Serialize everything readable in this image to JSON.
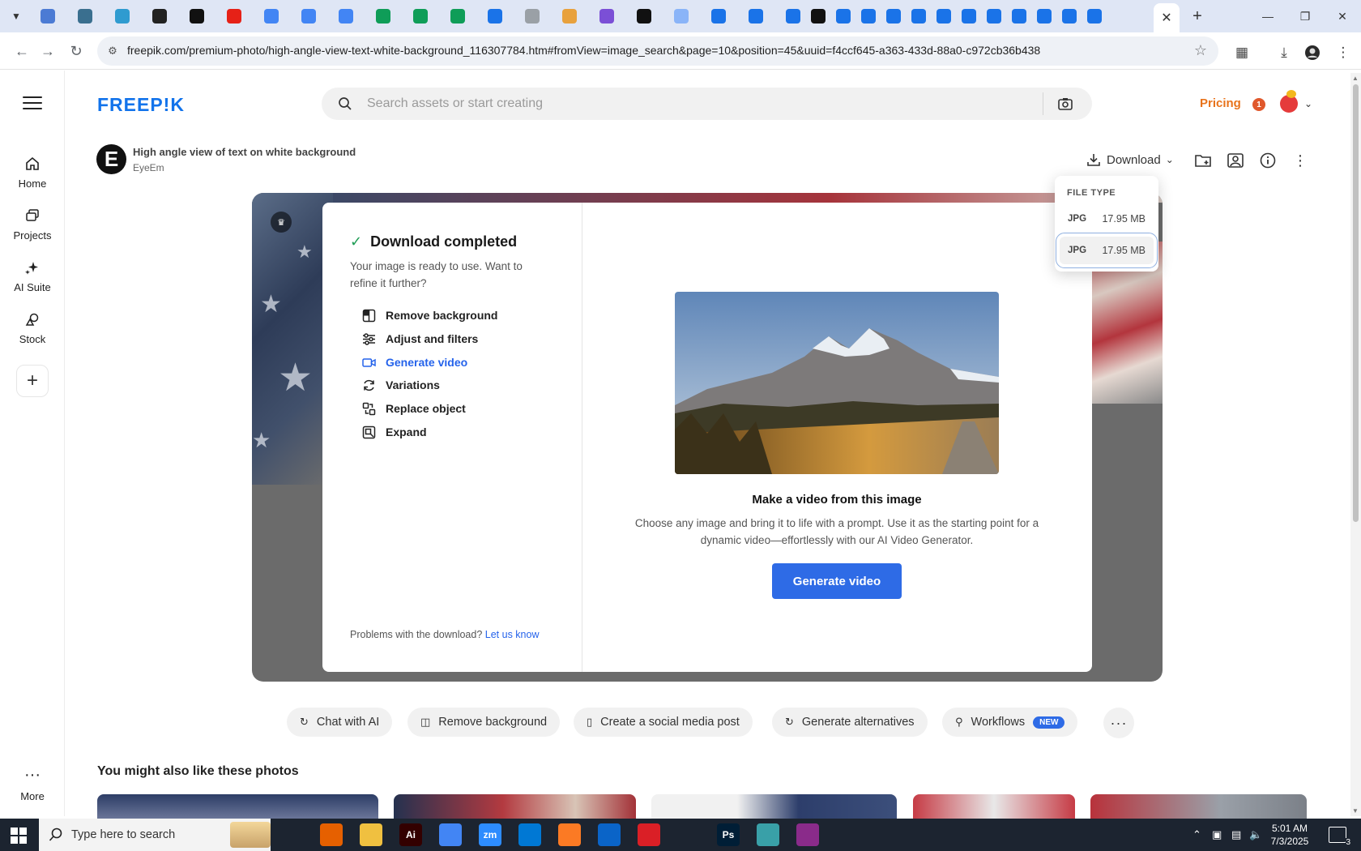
{
  "browser": {
    "url": "freepik.com/premium-photo/high-angle-view-text-white-background_116307784.htm#fromView=image_search&page=10&position=45&uuid=f4ccf645-a363-433d-88a0-c972cb36b438",
    "favicon_colors": [
      "#4c7bd4",
      "#3a6f8f",
      "#2f9bd0",
      "#222222",
      "#111111",
      "#e62117",
      "#4285f4",
      "#4285f4",
      "#4285f4",
      "#0f9d58",
      "#0f9d58",
      "#0f9d58",
      "#1a73e8",
      "#9aa0a6",
      "#e8a13d",
      "#7b4fd6",
      "#111111",
      "#8ab4f8",
      "#1a73e8",
      "#1a73e8",
      "#1a73e8",
      "#111111",
      "#1a73e8",
      "#1a73e8",
      "#1a73e8",
      "#1a73e8",
      "#1a73e8",
      "#1a73e8",
      "#1a73e8",
      "#1a73e8",
      "#1a73e8",
      "#1a73e8",
      "#1a73e8"
    ]
  },
  "header": {
    "logo": "FREEP!K",
    "search_placeholder": "Search assets or start creating",
    "pricing_label": "Pricing",
    "notification_count": "1"
  },
  "sidebar": {
    "items": [
      {
        "label": "Home",
        "icon": "home-icon"
      },
      {
        "label": "Projects",
        "icon": "projects-icon"
      },
      {
        "label": "AI Suite",
        "icon": "sparkle-icon"
      },
      {
        "label": "Stock",
        "icon": "stock-icon"
      }
    ],
    "more_label": "More"
  },
  "asset": {
    "author_initial": "E",
    "title": "High angle view of text on white background",
    "author": "EyeEm",
    "download_label": "Download"
  },
  "file_type": {
    "heading": "FILE TYPE",
    "options": [
      {
        "type": "JPG",
        "size": "17.95 MB"
      },
      {
        "type": "JPG",
        "size": "17.95 MB"
      }
    ]
  },
  "modal": {
    "title": "Download completed",
    "subtitle": "Your image is ready to use. Want to refine it further?",
    "actions": [
      {
        "label": "Remove background",
        "icon": "remove-background-icon"
      },
      {
        "label": "Adjust and filters",
        "icon": "sliders-icon"
      },
      {
        "label": "Generate video",
        "icon": "video-icon"
      },
      {
        "label": "Variations",
        "icon": "refresh-icon"
      },
      {
        "label": "Replace object",
        "icon": "replace-object-icon"
      },
      {
        "label": "Expand",
        "icon": "expand-icon"
      }
    ],
    "problem_text": "Problems with the download?",
    "problem_link": "Let us know",
    "video_title": "Make a video from this image",
    "video_desc": "Choose any image and bring it to life with a prompt. Use it as the starting point for a dynamic video—effortlessly with our AI Video Generator.",
    "video_button": "Generate video"
  },
  "chips": [
    {
      "label": "Chat with AI",
      "icon": "chat-icon"
    },
    {
      "label": "Remove background",
      "icon": "remove-background-icon"
    },
    {
      "label": "Create a social media post",
      "icon": "phone-icon"
    },
    {
      "label": "Generate alternatives",
      "icon": "refresh-icon"
    },
    {
      "label": "Workflows",
      "icon": "workflow-icon",
      "badge": "NEW"
    }
  ],
  "related": {
    "title": "You might also like these photos"
  },
  "taskbar": {
    "search_placeholder": "Type here to search",
    "time": "5:01 AM",
    "date": "7/3/2025",
    "notification_count": "3",
    "apps": [
      {
        "name": "task-view",
        "color": "#1c2430",
        "text": ""
      },
      {
        "name": "firefox",
        "color": "#e66000",
        "text": ""
      },
      {
        "name": "file-explorer",
        "color": "#f0c040",
        "text": ""
      },
      {
        "name": "illustrator",
        "color": "#330000",
        "text": "Ai"
      },
      {
        "name": "chrome",
        "color": "#4285f4",
        "text": ""
      },
      {
        "name": "zoom",
        "color": "#2d8cff",
        "text": "zm"
      },
      {
        "name": "vscode",
        "color": "#0078d4",
        "text": ""
      },
      {
        "name": "xampp",
        "color": "#fb7a24",
        "text": ""
      },
      {
        "name": "outlook",
        "color": "#0a64c8",
        "text": ""
      },
      {
        "name": "creative-cloud",
        "color": "#da1f26",
        "text": ""
      },
      {
        "name": "pen-tool",
        "color": "#1c2430",
        "text": ""
      },
      {
        "name": "photoshop",
        "color": "#001e36",
        "text": "Ps"
      },
      {
        "name": "app-diamond",
        "color": "#39a0a8",
        "text": ""
      },
      {
        "name": "winrar",
        "color": "#8a2b8a",
        "text": ""
      }
    ]
  }
}
